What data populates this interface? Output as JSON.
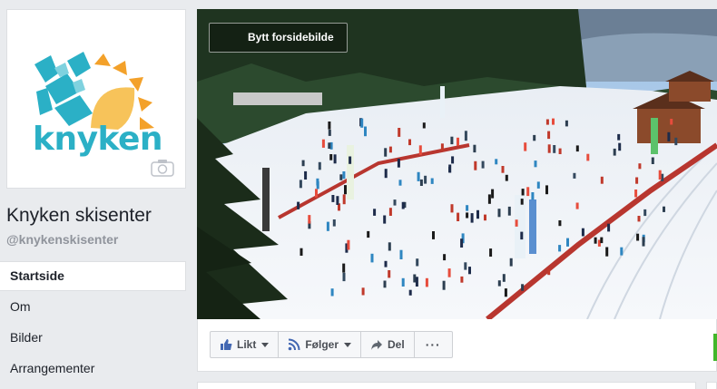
{
  "page": {
    "logo_text": "knyken",
    "name": "Knyken skisenter",
    "handle": "@knykenskisenter"
  },
  "nav": {
    "items": [
      {
        "label": "Startside",
        "active": true
      },
      {
        "label": "Om"
      },
      {
        "label": "Bilder"
      },
      {
        "label": "Arrangementer"
      }
    ]
  },
  "cover": {
    "change_label": "Bytt forsidebilde"
  },
  "actions": {
    "like_label": "Likt",
    "follow_label": "Følger",
    "share_label": "Del",
    "more_label": "···"
  },
  "icons": {
    "camera": "camera-icon",
    "like": "thumbs-up-icon",
    "follow": "rss-icon",
    "share": "share-arrow-icon",
    "more": "more-icon"
  },
  "colors": {
    "brand_blue": "#2bb0c6",
    "sun_orange": "#f3a12a",
    "link_blue": "#4267b2",
    "background": "#e9ebee"
  }
}
